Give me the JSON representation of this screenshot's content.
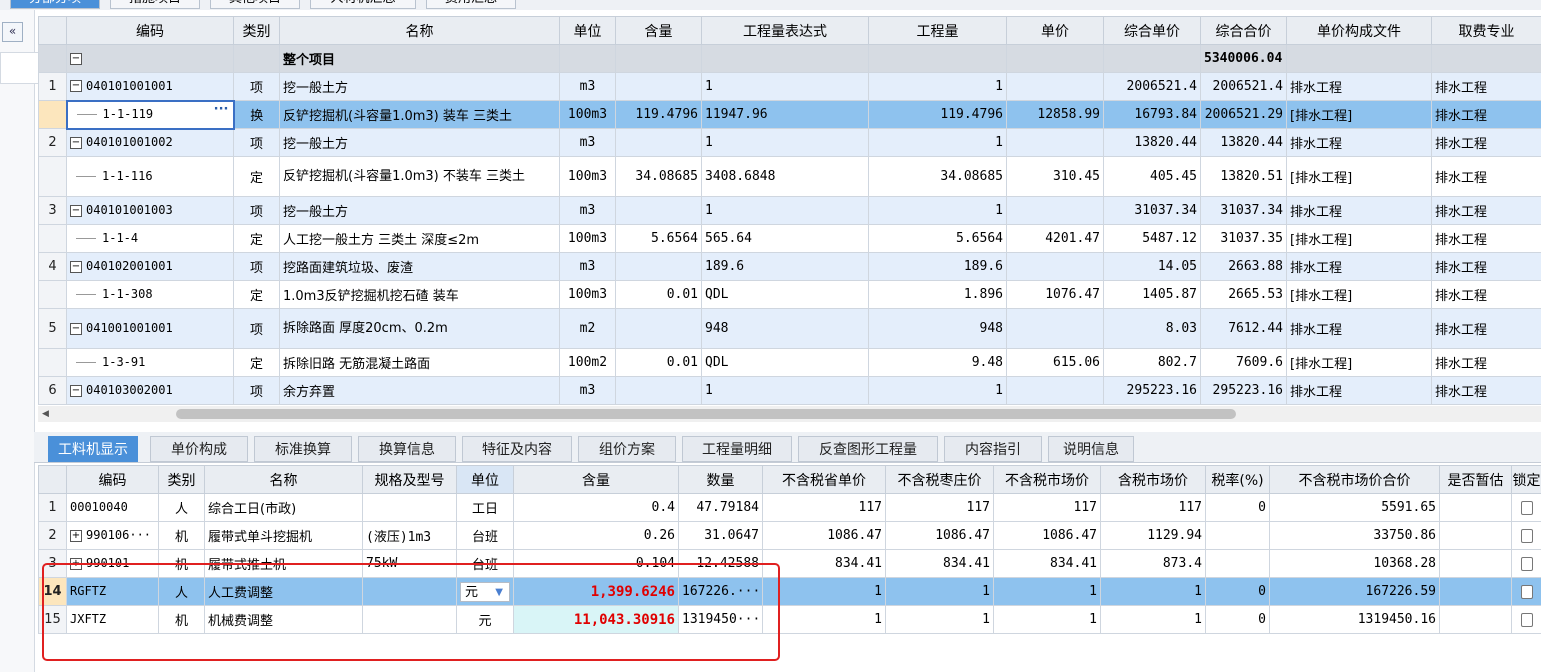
{
  "top_tabs": [
    {
      "label": "分部分项",
      "active": true
    },
    {
      "label": "措施项目",
      "active": false
    },
    {
      "label": "其他项目",
      "active": false
    },
    {
      "label": "人材机汇总",
      "active": false
    },
    {
      "label": "费用汇总",
      "active": false
    }
  ],
  "collapse_label": "«",
  "upper": {
    "headers": [
      "编码",
      "类别",
      "名称",
      "单位",
      "含量",
      "工程量表达式",
      "工程量",
      "单价",
      "综合单价",
      "综合合价",
      "单价构成文件",
      "取费专业"
    ],
    "group_row": {
      "toggle": "−",
      "name": "整个项目",
      "total": "5340006.04"
    },
    "rows": [
      {
        "rownum": "1",
        "type": "item",
        "code": "040101001001",
        "cat": "项",
        "name": "挖一般土方",
        "unit": "m3",
        "content": "",
        "expr": "1",
        "qty": "1",
        "price": "",
        "uprice": "2006521.4",
        "total": "2006521.4",
        "file": "排水工程",
        "prof": "排水工程"
      },
      {
        "rownum": "",
        "type": "sub",
        "selected": true,
        "code": "1-1-119",
        "cat": "换",
        "name": "反铲挖掘机(斗容量1.0m3) 装车 三类土",
        "unit": "100m3",
        "content": "119.4796",
        "expr": "11947.96",
        "qty": "119.4796",
        "price": "12858.99",
        "uprice": "16793.84",
        "total": "2006521.29",
        "file": "[排水工程]",
        "prof": "排水工程"
      },
      {
        "rownum": "2",
        "type": "item",
        "code": "040101001002",
        "cat": "项",
        "name": "挖一般土方",
        "unit": "m3",
        "content": "",
        "expr": "1",
        "qty": "1",
        "price": "",
        "uprice": "13820.44",
        "total": "13820.44",
        "file": "排水工程",
        "prof": "排水工程"
      },
      {
        "rownum": "",
        "type": "sub",
        "tall": true,
        "code": "1-1-116",
        "cat": "定",
        "name": "反铲挖掘机(斗容量1.0m3) 不装车 三类土",
        "unit": "100m3",
        "content": "34.08685",
        "expr": "3408.6848",
        "qty": "34.08685",
        "price": "310.45",
        "uprice": "405.45",
        "total": "13820.51",
        "file": "[排水工程]",
        "prof": "排水工程"
      },
      {
        "rownum": "3",
        "type": "item",
        "code": "040101001003",
        "cat": "项",
        "name": "挖一般土方",
        "unit": "m3",
        "content": "",
        "expr": "1",
        "qty": "1",
        "price": "",
        "uprice": "31037.34",
        "total": "31037.34",
        "file": "排水工程",
        "prof": "排水工程"
      },
      {
        "rownum": "",
        "type": "sub",
        "code": "1-1-4",
        "cat": "定",
        "name": "人工挖一般土方 三类土 深度≤2m",
        "unit": "100m3",
        "content": "5.6564",
        "expr": "565.64",
        "qty": "5.6564",
        "price": "4201.47",
        "uprice": "5487.12",
        "total": "31037.35",
        "file": "[排水工程]",
        "prof": "排水工程"
      },
      {
        "rownum": "4",
        "type": "item",
        "code": "040102001001",
        "cat": "项",
        "name": "挖路面建筑垃圾、废渣",
        "unit": "m3",
        "content": "",
        "expr": "189.6",
        "qty": "189.6",
        "price": "",
        "uprice": "14.05",
        "total": "2663.88",
        "file": "排水工程",
        "prof": "排水工程"
      },
      {
        "rownum": "",
        "type": "sub",
        "code": "1-1-308",
        "cat": "定",
        "name": "1.0m3反铲挖掘机挖石碴 装车",
        "unit": "100m3",
        "content": "0.01",
        "expr": "QDL",
        "qty": "1.896",
        "price": "1076.47",
        "uprice": "1405.87",
        "total": "2665.53",
        "file": "[排水工程]",
        "prof": "排水工程"
      },
      {
        "rownum": "5",
        "type": "item",
        "tall": true,
        "code": "041001001001",
        "cat": "项",
        "name": "拆除路面 厚度20cm、0.2m",
        "unit": "m2",
        "content": "",
        "expr": "948",
        "qty": "948",
        "price": "",
        "uprice": "8.03",
        "total": "7612.44",
        "file": "排水工程",
        "prof": "排水工程"
      },
      {
        "rownum": "",
        "type": "sub",
        "code": "1-3-91",
        "cat": "定",
        "name": "拆除旧路 无筋混凝土路面",
        "unit": "100m2",
        "content": "0.01",
        "expr": "QDL",
        "qty": "9.48",
        "price": "615.06",
        "uprice": "802.7",
        "total": "7609.6",
        "file": "[排水工程]",
        "prof": "排水工程"
      },
      {
        "rownum": "6",
        "type": "item",
        "code": "040103002001",
        "cat": "项",
        "name": "余方弃置",
        "unit": "m3",
        "content": "",
        "expr": "1",
        "qty": "1",
        "price": "",
        "uprice": "295223.16",
        "total": "295223.16",
        "file": "排水工程",
        "prof": "排水工程"
      }
    ]
  },
  "lower_tabs": [
    {
      "label": "工料机显示",
      "active": true
    },
    {
      "label": "单价构成",
      "active": false
    },
    {
      "label": "标准换算",
      "active": false
    },
    {
      "label": "换算信息",
      "active": false
    },
    {
      "label": "特征及内容",
      "active": false
    },
    {
      "label": "组价方案",
      "active": false
    },
    {
      "label": "工程量明细",
      "active": false
    },
    {
      "label": "反查图形工程量",
      "active": false
    },
    {
      "label": "内容指引",
      "active": false
    },
    {
      "label": "说明信息",
      "active": false
    }
  ],
  "lower": {
    "headers": [
      "编码",
      "类别",
      "名称",
      "规格及型号",
      "单位",
      "含量",
      "数量",
      "不含税省单价",
      "不含税枣庄价",
      "不含税市场价",
      "含税市场价",
      "税率(%)",
      "不含税市场价合价",
      "是否暂估",
      "锁定"
    ],
    "rows": [
      {
        "rownum": "1",
        "code": "00010040",
        "cat": "人",
        "name": "综合工日(市政)",
        "spec": "",
        "unit": "工日",
        "content": "0.4",
        "qty": "47.79184",
        "p1": "117",
        "p2": "117",
        "p3": "117",
        "p4": "117",
        "tax": "0",
        "total": "5591.65"
      },
      {
        "rownum": "2",
        "expand": "+",
        "code": "990106···",
        "cat": "机",
        "name": "履带式单斗挖掘机",
        "spec": "(液压)1m3",
        "unit": "台班",
        "content": "0.26",
        "qty": "31.0647",
        "p1": "1086.47",
        "p2": "1086.47",
        "p3": "1086.47",
        "p4": "1129.94",
        "tax": "",
        "total": "33750.86"
      },
      {
        "rownum": "3",
        "expand": "+",
        "code": "990101",
        "cat": "机",
        "name": "履带式推土机",
        "spec": "75kW",
        "unit": "台班",
        "content": "0.104",
        "qty": "12.42588",
        "p1": "834.41",
        "p2": "834.41",
        "p3": "834.41",
        "p4": "873.4",
        "tax": "",
        "total": "10368.28"
      },
      {
        "rownum": "14",
        "selected": true,
        "code": "RGFTZ",
        "cat": "人",
        "name": "人工费调整",
        "spec": "",
        "unit": "元",
        "content": "1,399.6246",
        "qty": "167226.···",
        "p1": "1",
        "p2": "1",
        "p3": "1",
        "p4": "1",
        "tax": "0",
        "total": "167226.59"
      },
      {
        "rownum": "15",
        "code": "JXFTZ",
        "cat": "机",
        "name": "机械费调整",
        "spec": "",
        "unit": "元",
        "content": "11,043.30916",
        "qty": "1319450···",
        "p1": "1",
        "p2": "1",
        "p3": "1",
        "p4": "1",
        "tax": "0",
        "total": "1319450.16"
      }
    ]
  }
}
